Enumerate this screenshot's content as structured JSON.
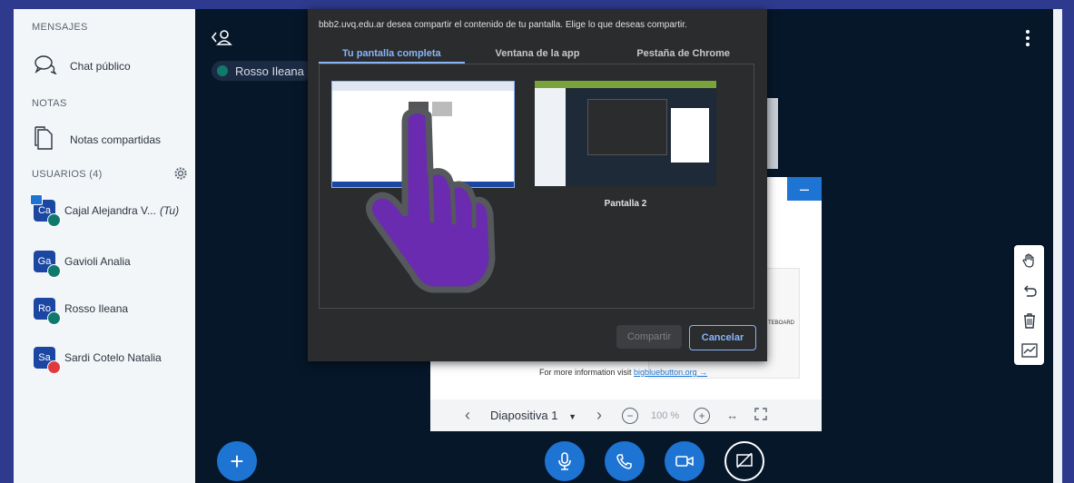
{
  "sidebar": {
    "messages_title": "MENSAJES",
    "public_chat": "Chat público",
    "notes_title": "NOTAS",
    "shared_notes": "Notas compartidas",
    "users_title": "USUARIOS (4)",
    "users": [
      {
        "initials": "Ca",
        "name": "Cajal Alejandra V...",
        "suffix": "(Tu)",
        "mic": "muted-green"
      },
      {
        "initials": "Ga",
        "name": "Gavioli Analia",
        "suffix": "",
        "mic": "muted-green"
      },
      {
        "initials": "Ro",
        "name": "Rosso Ileana",
        "suffix": "",
        "mic": "muted-green"
      },
      {
        "initials": "Sa",
        "name": "Sardi Cotelo Natalia",
        "suffix": "",
        "mic": "muted-red"
      }
    ]
  },
  "main": {
    "talker": "Rosso Ileana"
  },
  "dialog": {
    "message": "bbb2.uvq.edu.ar desea compartir el contenido de tu pantalla. Elige lo que deseas compartir.",
    "tabs": [
      "Tu pantalla completa",
      "Ventana de la app",
      "Pestaña de Chrome"
    ],
    "screen2_label": "Pantalla 2",
    "share_button": "Compartir",
    "cancel_button": "Cancelar"
  },
  "slide": {
    "info_text": "For more information visit",
    "info_link": "bigbluebutton.org →",
    "partial_label": "TEBOARD",
    "slide_label": "Diapositiva 1",
    "zoom": "100 %"
  },
  "colors": {
    "frame": "#2e3a8e",
    "accent": "#1e74d3",
    "hand": "#6a2bb0"
  }
}
